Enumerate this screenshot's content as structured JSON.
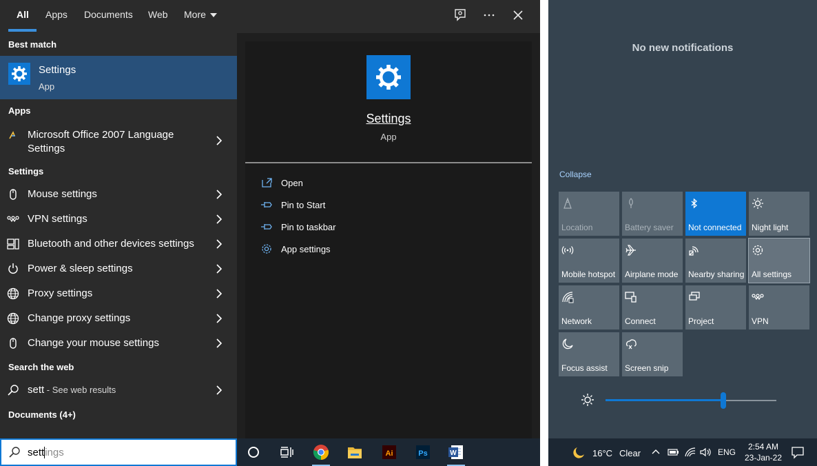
{
  "search": {
    "tabs": [
      "All",
      "Apps",
      "Documents",
      "Web",
      "More"
    ],
    "sections": {
      "best_match": "Best match",
      "apps": "Apps",
      "settings": "Settings",
      "search_web": "Search the web",
      "documents": "Documents (4+)"
    },
    "best_match": {
      "title": "Settings",
      "subtitle": "App"
    },
    "app_results": [
      {
        "line1": "Microsoft Office 2007 Language",
        "line2": "Settings"
      }
    ],
    "settings_results": [
      "Mouse settings",
      "VPN settings",
      "Bluetooth and other devices settings",
      "Power & sleep settings",
      "Proxy settings",
      "Change proxy settings",
      "Change your mouse settings"
    ],
    "web_result": {
      "query": "sett",
      "suffix": " - See web results"
    },
    "preview": {
      "title": "Settings",
      "subtitle": "App",
      "actions": [
        "Open",
        "Pin to Start",
        "Pin to taskbar",
        "App settings"
      ]
    },
    "input": {
      "typed": "sett",
      "suggestion": "ings"
    }
  },
  "taskbar": {
    "apps": [
      "cortana-icon",
      "task-view-icon",
      "chrome-icon",
      "file-explorer-icon",
      "illustrator-icon",
      "photoshop-icon",
      "word-icon"
    ]
  },
  "action_center": {
    "no_notifications": "No new notifications",
    "collapse": "Collapse",
    "tiles": [
      {
        "label": "Location",
        "icon": "location-icon",
        "state": "disabled"
      },
      {
        "label": "Battery saver",
        "icon": "battery-saver-icon",
        "state": "disabled"
      },
      {
        "label": "Not connected",
        "icon": "bluetooth-icon",
        "state": "on"
      },
      {
        "label": "Night light",
        "icon": "night-light-icon",
        "state": "off"
      },
      {
        "label": "Mobile hotspot",
        "icon": "mobile-hotspot-icon",
        "state": "off"
      },
      {
        "label": "Airplane mode",
        "icon": "airplane-icon",
        "state": "off"
      },
      {
        "label": "Nearby sharing",
        "icon": "nearby-sharing-icon",
        "state": "off"
      },
      {
        "label": "All settings",
        "icon": "gear-icon",
        "state": "selected"
      },
      {
        "label": "Network",
        "icon": "network-icon",
        "state": "off"
      },
      {
        "label": "Connect",
        "icon": "connect-icon",
        "state": "off"
      },
      {
        "label": "Project",
        "icon": "project-icon",
        "state": "off"
      },
      {
        "label": "VPN",
        "icon": "vpn-icon",
        "state": "off"
      },
      {
        "label": "Focus assist",
        "icon": "moon-icon",
        "state": "off"
      },
      {
        "label": "Screen snip",
        "icon": "screen-snip-icon",
        "state": "off"
      }
    ],
    "brightness_fraction": 0.69
  },
  "tray": {
    "weather": "16°C",
    "condition": "Clear",
    "language": "ENG",
    "time": "2:54 AM",
    "date": "23-Jan-22"
  },
  "colors": {
    "accent": "#0f78d4",
    "best_match_bg": "#28507a"
  }
}
